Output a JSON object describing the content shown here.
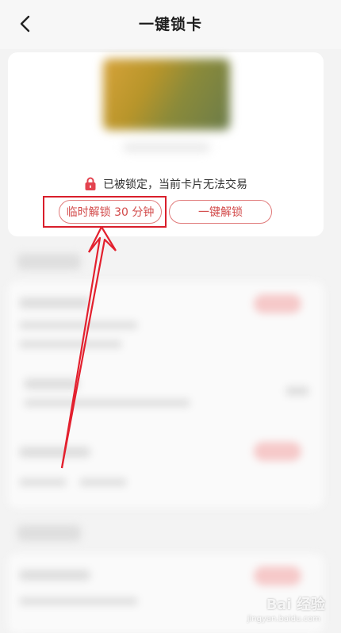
{
  "header": {
    "title": "一键锁卡",
    "back_icon": "chevron-left-icon"
  },
  "card": {
    "lock_icon": "lock-icon",
    "lock_status_text": "已被锁定，当前卡片无法交易",
    "buttons": {
      "temp_unlock_label": "临时解锁 30 分钟",
      "one_click_unlock_label": "一键解锁"
    }
  },
  "colors": {
    "accent": "#d24a4a",
    "highlight": "#d91e2b",
    "lock_icon": "#e3434f"
  },
  "watermark": {
    "brand": "Bai 经验",
    "url": "jingyan.baidu.com"
  }
}
